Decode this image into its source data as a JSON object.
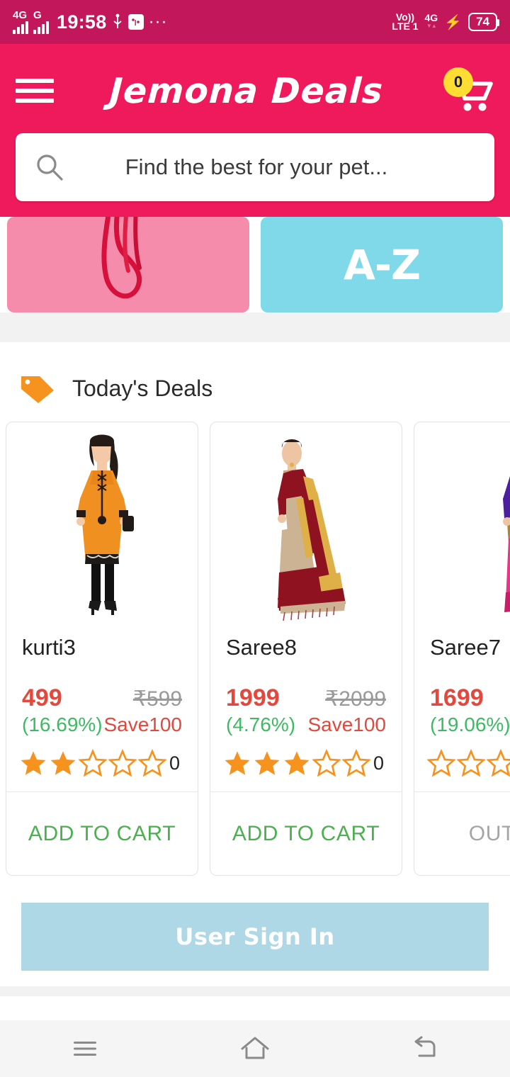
{
  "status_bar": {
    "network_primary": "4G",
    "network_secondary": "G",
    "time": "19:58",
    "overflow_dots": "···",
    "volte_label": "Vo))",
    "volte_sim": "LTE 1",
    "network_right": "4G",
    "battery_percent": "74"
  },
  "header": {
    "menu_icon": "hamburger-menu-icon",
    "brand_title": "Jemona Deals",
    "cart_icon": "shopping-cart-icon",
    "cart_count": "0",
    "background_color": "#ef1a5b",
    "badge_color": "#ffdd33"
  },
  "search": {
    "icon": "search-icon",
    "placeholder": "Find the best for your pet...",
    "value": ""
  },
  "banners": [
    {
      "name": "pink-cord-banner",
      "label": "",
      "color": "#f58cab"
    },
    {
      "name": "a-to-z-banner",
      "label": "A-Z",
      "color": "#7fd9e8"
    }
  ],
  "deals_section": {
    "icon": "price-tag-icon",
    "icon_color": "#f6921e",
    "title": "Today's Deals"
  },
  "products": [
    {
      "name": "kurti3",
      "price": "499",
      "old_price": "₹599",
      "discount": "(16.69%)",
      "save": "Save100",
      "rating": 2,
      "rating_count": "0",
      "action_label": "ADD TO CART",
      "in_stock": true,
      "image": "orange-kurti-model"
    },
    {
      "name": "Saree8",
      "price": "1999",
      "old_price": "₹2099",
      "discount": "(4.76%)",
      "save": "Save100",
      "rating": 3,
      "rating_count": "0",
      "action_label": "ADD TO CART",
      "in_stock": true,
      "image": "maroon-beige-saree-model"
    },
    {
      "name": "Saree7",
      "price": "1699",
      "old_price": "",
      "discount": "(19.06%)",
      "save": "",
      "rating": 0,
      "rating_count": "",
      "action_label": "OUT OF",
      "in_stock": false,
      "image": "purple-pink-saree-model"
    }
  ],
  "signin": {
    "label": "User Sign In",
    "color": "#aed8e6"
  },
  "nav_bar": {
    "recents_icon": "menu-icon",
    "home_icon": "home-icon",
    "back_icon": "back-icon"
  },
  "colors": {
    "brand_pink": "#ef1a5b",
    "status_pink": "#c2185b",
    "price_red": "#e2483c",
    "discount_green": "#3dba62",
    "star_orange": "#f6921e"
  }
}
